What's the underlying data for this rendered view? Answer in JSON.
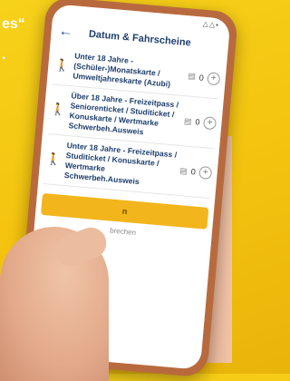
{
  "background_text": {
    "line1": "es“",
    "line2": "."
  },
  "status_bar": {
    "time": "",
    "icons": "△△▪"
  },
  "header": {
    "back_icon": "arrow-left-icon",
    "title": "Datum & Fahrscheine"
  },
  "ticket_rows": [
    {
      "label": "Unter 18 Jahre - (Schüler-)Monatskarte / Umweltjahreskarte (Azubi)",
      "count": "0"
    },
    {
      "label": "Über 18 Jahre - Freizeitpass / Seniorenticket / Studiticket / Konuskarte / Wertmarke Schwerbeh.Ausweis",
      "count": "0"
    },
    {
      "label": "Unter 18 Jahre - Freizeitpass / Studiticket / Konuskarte / Wertmarke Schwerbeh.Ausweis",
      "count": "0"
    }
  ],
  "buttons": {
    "primary": "n",
    "secondary": "brechen"
  },
  "colors": {
    "background": "#f3c20f",
    "accent": "#f2b51b",
    "title": "#1d3f6e",
    "phone_case": "#b86a3e"
  }
}
